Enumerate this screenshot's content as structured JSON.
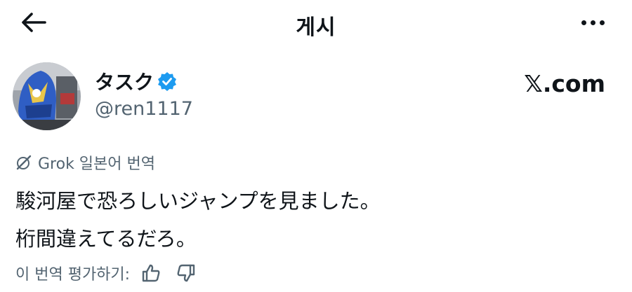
{
  "header": {
    "title": "게시",
    "back_icon": "arrow-left-icon",
    "more_icon": "more-horizontal-icon"
  },
  "author": {
    "display_name": "タスク",
    "handle": "@ren1117",
    "verified": true,
    "verified_color": "#1d9bf0",
    "brand": "𝕏.com"
  },
  "translation": {
    "label": "Grok 일본어 번역",
    "icon": "grok-icon"
  },
  "post": {
    "lines": [
      "駿河屋で恐ろしいジャンプを見ました。",
      "桁間違えてるだろ。"
    ]
  },
  "rating": {
    "label": "이 번역 평가하기:",
    "like_icon": "thumbs-up-icon",
    "dislike_icon": "thumbs-down-icon"
  },
  "colors": {
    "text": "#0f1419",
    "secondary": "#536471"
  }
}
